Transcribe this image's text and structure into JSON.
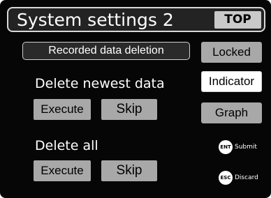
{
  "screen": {
    "title": "System settings 2",
    "top_button": "TOP"
  },
  "recorded": {
    "label": "Recorded data deletion"
  },
  "delete_newest": {
    "label": "Delete newest data",
    "execute": "Execute",
    "skip": "Skip"
  },
  "delete_all": {
    "label": "Delete all",
    "execute": "Execute",
    "skip": "Skip"
  },
  "side_menu": {
    "locked": "Locked",
    "indicator": "Indicator",
    "graph": "Graph"
  },
  "key_hints": {
    "submit_key": "ENT",
    "submit_text": "Submit",
    "discard_key": "ESC",
    "discard_text": "Discard"
  },
  "colors": {
    "background": "#060606",
    "button_gray": "#a8a8a8",
    "top_button": "#c9c9c9",
    "selected": "#ffffff",
    "text": "#ffffff"
  }
}
